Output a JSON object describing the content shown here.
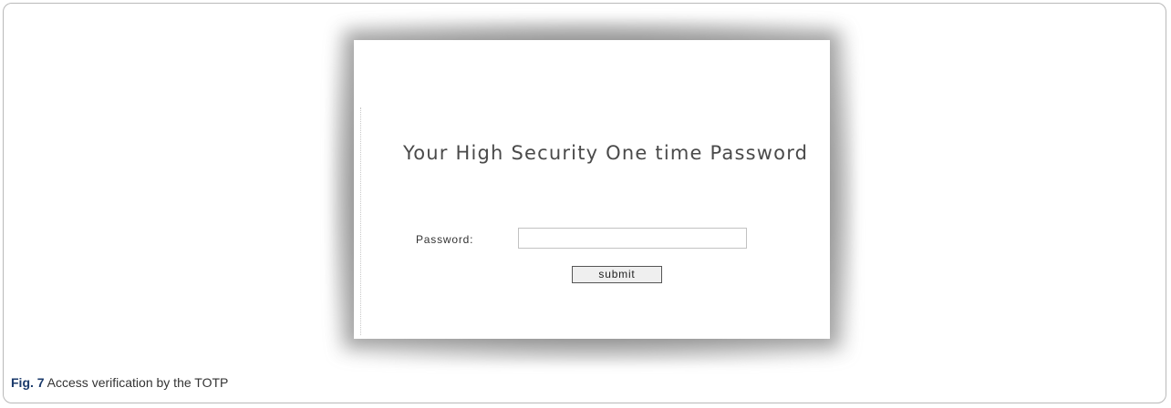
{
  "screen": {
    "title": "Your High Security One time Password",
    "password_label": "Password:",
    "password_value": "",
    "submit_label": "submit"
  },
  "caption": {
    "label": "Fig. 7",
    "text": " Access verification by the TOTP"
  }
}
